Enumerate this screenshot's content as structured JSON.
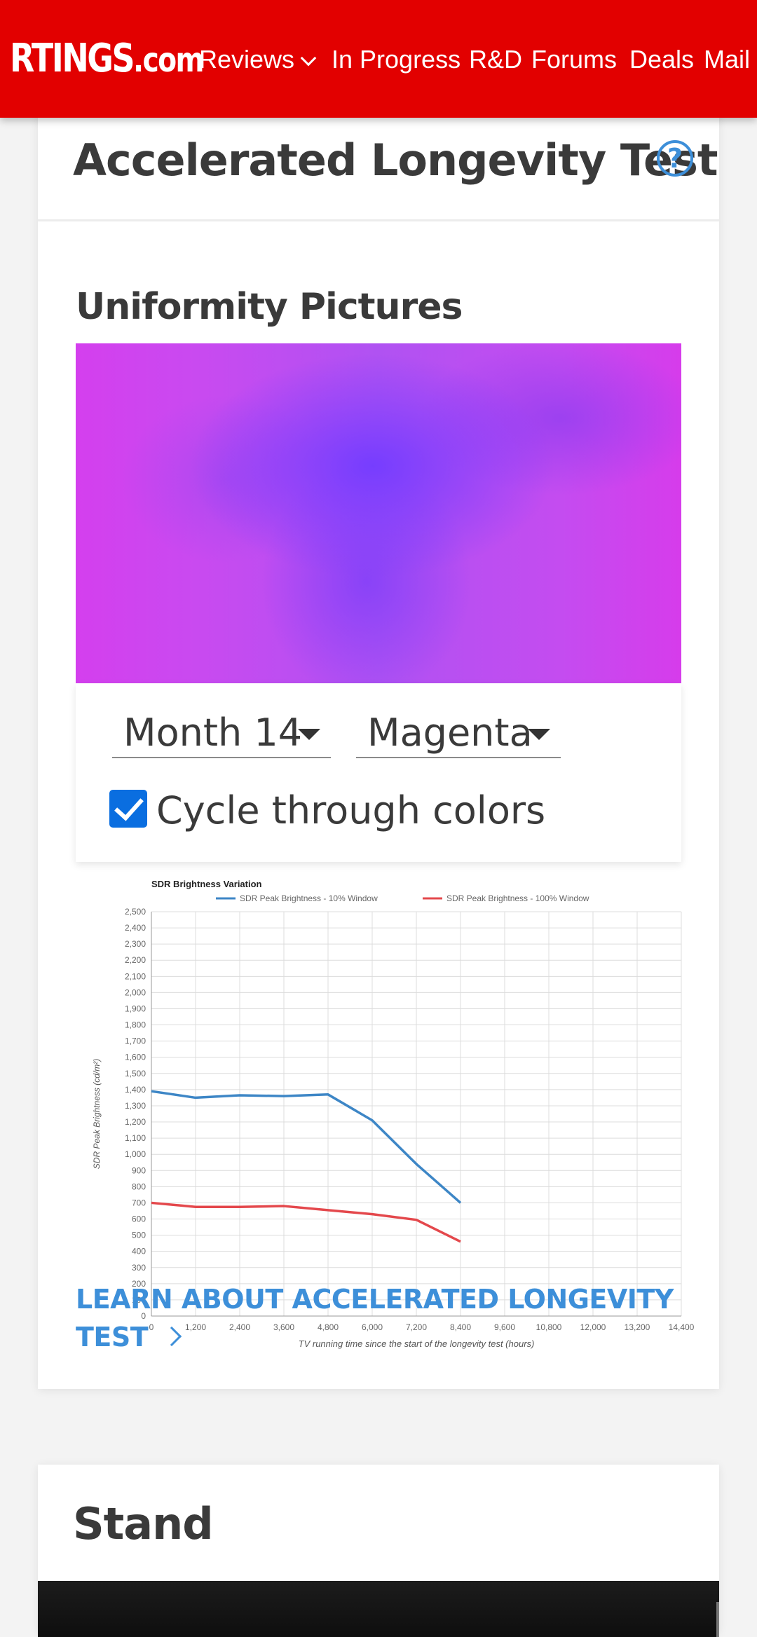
{
  "nav": {
    "logo_main": "RTINGS",
    "logo_suffix": ".com",
    "items": [
      "Reviews",
      "In Progress",
      "R&D",
      "Forums",
      "Deals",
      "Mail"
    ]
  },
  "longevity": {
    "title": "Accelerated Longevity Test",
    "help_symbol": "?",
    "section_title": "Uniformity Pictures",
    "month_select": "Month 14",
    "color_select": "Magenta",
    "cycle_label": "Cycle through colors",
    "cycle_checked": true,
    "learn_link": "LEARN ABOUT ACCELERATED LONGEVITY TEST"
  },
  "stand": {
    "title": "Stand"
  },
  "colors": {
    "brand_red": "#e20000",
    "link_blue": "#3d8fd9",
    "series_blue": "#3d86c6",
    "series_red": "#e4484c"
  },
  "chart_data": {
    "type": "line",
    "title": "SDR Brightness Variation",
    "xlabel": "TV running time since the start of the longevity test (hours)",
    "ylabel": "SDR Peak Brightness (cd/m²)",
    "xlim": [
      0,
      14400
    ],
    "ylim": [
      0,
      2500
    ],
    "x_ticks": [
      "0",
      "1,200",
      "2,400",
      "3,600",
      "4,800",
      "6,000",
      "7,200",
      "8,400",
      "9,600",
      "10,800",
      "12,000",
      "13,200",
      "14,400"
    ],
    "y_ticks": [
      "0",
      "100",
      "200",
      "300",
      "400",
      "500",
      "600",
      "700",
      "800",
      "900",
      "1,000",
      "1,100",
      "1,200",
      "1,300",
      "1,400",
      "1,500",
      "1,600",
      "1,700",
      "1,800",
      "1,900",
      "2,000",
      "2,100",
      "2,200",
      "2,300",
      "2,400",
      "2,500"
    ],
    "grid": true,
    "legend_position": "top",
    "series": [
      {
        "name": "SDR Peak Brightness - 10% Window",
        "x": [
          0,
          1200,
          2400,
          3600,
          4800,
          6000,
          7200,
          8400
        ],
        "values": [
          1390,
          1350,
          1365,
          1360,
          1370,
          1210,
          940,
          700
        ]
      },
      {
        "name": "SDR Peak Brightness - 100% Window",
        "x": [
          0,
          1200,
          2400,
          3600,
          4800,
          6000,
          7200,
          8400
        ],
        "values": [
          700,
          675,
          675,
          680,
          655,
          630,
          595,
          460
        ]
      }
    ]
  }
}
